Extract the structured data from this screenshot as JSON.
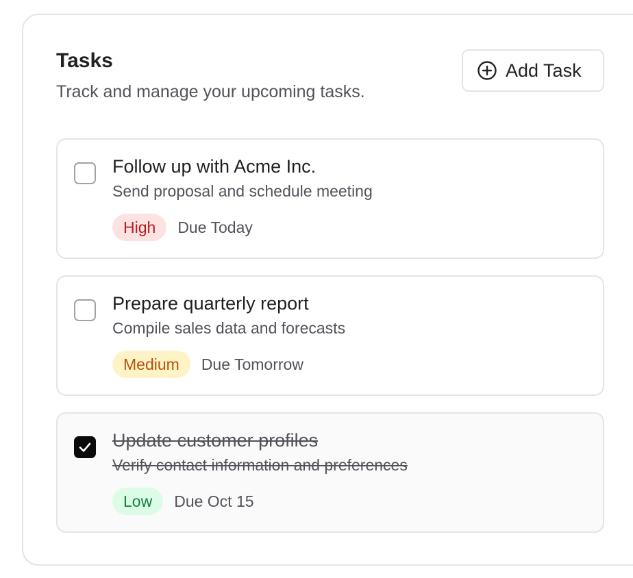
{
  "header": {
    "title": "Tasks",
    "subtitle": "Track and manage your upcoming tasks.",
    "add_button_label": "Add Task",
    "add_button_icon": "plus-circle-icon"
  },
  "tasks": [
    {
      "title": "Follow up with Acme Inc.",
      "description": "Send proposal and schedule meeting",
      "priority": "High",
      "due": "Due Today",
      "completed": false
    },
    {
      "title": "Prepare quarterly report",
      "description": "Compile sales data and forecasts",
      "priority": "Medium",
      "due": "Due Tomorrow",
      "completed": false
    },
    {
      "title": "Update customer profiles",
      "description": "Verify contact information and preferences",
      "priority": "Low",
      "due": "Due Oct 15",
      "completed": true
    }
  ],
  "colors": {
    "high_bg": "#fde2e2",
    "high_text": "#b91c1c",
    "medium_bg": "#fef3c7",
    "medium_text": "#b45309",
    "low_bg": "#dcfce7",
    "low_text": "#15803d",
    "checkbox_checked": "#0a0a0a"
  }
}
